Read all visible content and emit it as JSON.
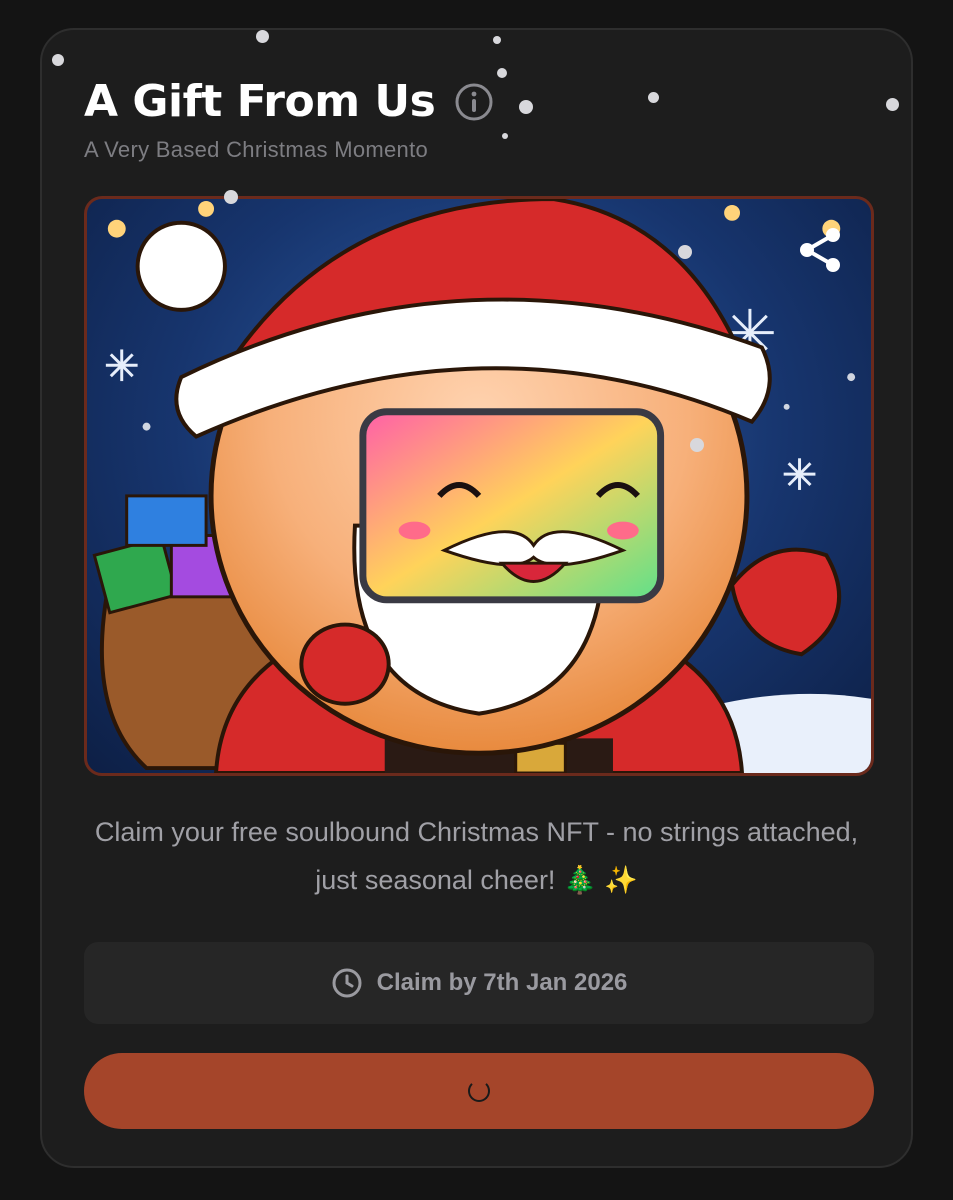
{
  "card": {
    "title": "A Gift From Us",
    "subtitle": "A Very Based Christmas Momento",
    "info_icon": "info-circle-icon"
  },
  "artwork": {
    "description": "Santa character NFT artwork",
    "share_icon": "share-icon"
  },
  "description": {
    "text": "Claim your free soulbound Christmas NFT - no strings attached, just seasonal cheer! 🎄 ✨"
  },
  "claim_deadline": {
    "icon": "clock-icon",
    "label": "Claim by 7th Jan 2026"
  },
  "claim_button": {
    "state": "loading",
    "icon": "spinner-icon",
    "color": "#a5452a"
  },
  "colors": {
    "background": "#141414",
    "card": "#1d1d1d",
    "accent": "#a5452a",
    "muted_text": "#a0a0a6"
  }
}
